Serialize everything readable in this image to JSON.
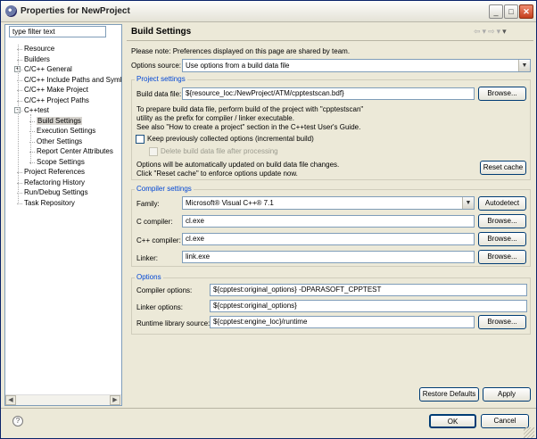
{
  "window": {
    "title": "Properties for NewProject"
  },
  "titlebar_buttons": [
    "minimize",
    "maximize",
    "close"
  ],
  "nav": {
    "filter_placeholder": "type filter text",
    "items": [
      {
        "label": "Resource",
        "level": 0
      },
      {
        "label": "Builders",
        "level": 0
      },
      {
        "label": "C/C++ General",
        "level": 0,
        "expander": "+"
      },
      {
        "label": "C/C++ Include Paths and Symb",
        "level": 0
      },
      {
        "label": "C/C++ Make Project",
        "level": 0
      },
      {
        "label": "C/C++ Project Paths",
        "level": 0
      },
      {
        "label": "C++test",
        "level": 0,
        "expander": "-"
      },
      {
        "label": "Build Settings",
        "level": 1,
        "selected": true
      },
      {
        "label": "Execution Settings",
        "level": 1
      },
      {
        "label": "Other Settings",
        "level": 1
      },
      {
        "label": "Report Center Attributes",
        "level": 1
      },
      {
        "label": "Scope Settings",
        "level": 1
      },
      {
        "label": "Project References",
        "level": 0
      },
      {
        "label": "Refactoring History",
        "level": 0
      },
      {
        "label": "Run/Debug Settings",
        "level": 0
      },
      {
        "label": "Task Repository",
        "level": 0
      }
    ]
  },
  "page": {
    "title": "Build Settings",
    "note": "Please note: Preferences displayed on this page are shared by team.",
    "options_source_label": "Options source:",
    "options_source_value": "Use options from a build data file",
    "project_settings": {
      "title": "Project settings",
      "build_data_file_label": "Build data file:",
      "build_data_file_value": "${resource_loc:/NewProject/ATM/cpptestscan.bdf}",
      "browse": "Browse...",
      "info_lines": [
        "To prepare build data file, perform build of the project with \"cpptestscan\"",
        "utility as the prefix for compiler / linker executable.",
        "See also \"How to create a project\" section in the C++test User's Guide."
      ],
      "keep_options_label": "Keep previously collected options (incremental build)",
      "delete_file_label": "Delete build data file after processing",
      "auto_update_lines": [
        "Options will be automatically updated on build data file changes.",
        "Click \"Reset cache\" to enforce options update now."
      ],
      "reset_cache": "Reset cache"
    },
    "compiler_settings": {
      "title": "Compiler settings",
      "family_label": "Family:",
      "family_value": "Microsoft® Visual C++® 7.1",
      "autodetect": "Autodetect",
      "c_compiler_label": "C compiler:",
      "c_compiler_value": "cl.exe",
      "cpp_compiler_label": "C++ compiler:",
      "cpp_compiler_value": "cl.exe",
      "linker_label": "Linker:",
      "linker_value": "link.exe",
      "browse": "Browse..."
    },
    "options": {
      "title": "Options",
      "compiler_options_label": "Compiler options:",
      "compiler_options_value": "${cpptest:original_options} -DPARASOFT_CPPTEST",
      "linker_options_label": "Linker options:",
      "linker_options_value": "${cpptest:original_options}",
      "runtime_label": "Runtime library source:",
      "runtime_value": "${cpptest:engine_loc}/runtime",
      "browse": "Browse..."
    },
    "restore_defaults": "Restore Defaults",
    "apply": "Apply"
  },
  "footer": {
    "ok": "OK",
    "cancel": "Cancel"
  },
  "colors": {
    "group_title": "#0046d5",
    "window_bg": "#ece9d8",
    "selection": "#d6d3ce"
  }
}
